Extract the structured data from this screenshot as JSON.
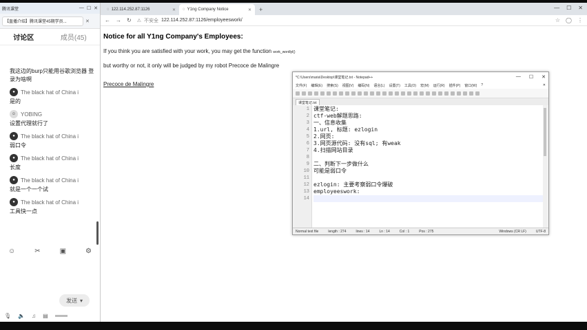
{
  "chat": {
    "title": "腾讯课堂",
    "tab_label": "【直播介绍】腾讯课堂45期学员...",
    "section_tabs": [
      "讨论区",
      "成员(45)"
    ],
    "messages": [
      {
        "user": "",
        "text": "我这边的burp只能用谷歌浏览器 登录为啥啊"
      },
      {
        "user": "The black hat of China i",
        "text": "是的"
      },
      {
        "user": "YOBING",
        "text": "设置代理就行了"
      },
      {
        "user": "The black hat of China i",
        "text": "弱口令"
      },
      {
        "user": "The black hat of China i",
        "text": "长度"
      },
      {
        "user": "The black hat of China i",
        "text": "就是一个一个试"
      },
      {
        "user": "The black hat of China i",
        "text": "工具快一点"
      }
    ],
    "tools": [
      "☺",
      "✂",
      "▣",
      "⚙"
    ],
    "send_label": "发送"
  },
  "browser": {
    "tabs": [
      {
        "label": "122.114.252.87:1126"
      },
      {
        "label": "Y1ng Company Notice"
      }
    ],
    "security_label": "不安全",
    "url": "122.114.252.87:1126/employeeswork/",
    "page": {
      "heading": "Notice for all Y1ng Company's Employees:",
      "line1": "If you think you are satisfied with your work, you may get the function",
      "line1_small": "work_wordlyl()",
      "line2": "but worthy or not, it only will be judged by my robot Precoce de Malingre",
      "link": "Precoce de Malingre"
    }
  },
  "notepad": {
    "title": "*C:\\Users\\maria\\Desktop\\课堂笔记.txt - Notepad++",
    "menu": [
      "文件(F)",
      "编辑(E)",
      "搜索(S)",
      "视图(V)",
      "编码(N)",
      "语言(L)",
      "设置(T)",
      "工具(O)",
      "宏(M)",
      "运行(R)",
      "插件(P)",
      "窗口(W)",
      "?"
    ],
    "tab": "课堂笔记.txt",
    "lines": [
      "课堂笔记:",
      "ctf-web解题思路:",
      "一、信息收集",
      "1.url, 标题: ezlogin",
      "2.网页:",
      "3.网页源代码: 没有sql; 有weak",
      "4.扫描网站目录",
      "",
      "二、判断下一步做什么",
      "可能是弱口令",
      "",
      "ezlogin: 主要考察弱口令爆破",
      "employeeswork:",
      ""
    ],
    "line_numbers": [
      "1",
      "2",
      "3",
      "4",
      "5",
      "6",
      "7",
      "8",
      "9",
      "10",
      "11",
      "12",
      "13",
      "14"
    ],
    "status": {
      "type": "Normal text file",
      "length": "length : 274",
      "lines": "lines : 14",
      "ln": "Ln : 14",
      "col": "Col : 1",
      "pos": "Pos : 275",
      "eol": "Windows (CR LF)",
      "enc": "UTF-8"
    }
  }
}
